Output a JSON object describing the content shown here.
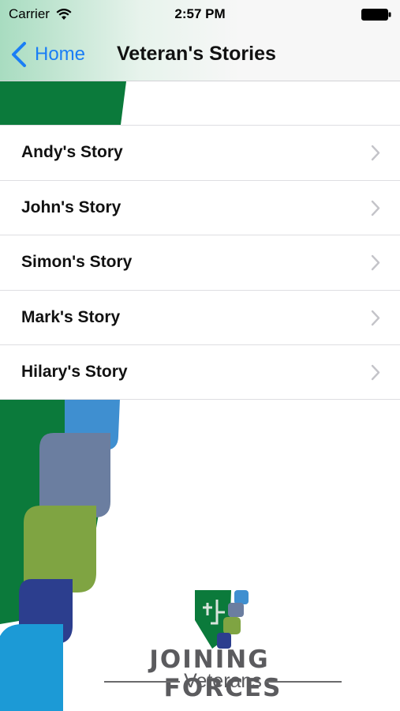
{
  "status_bar": {
    "carrier": "Carrier",
    "time": "2:57 PM"
  },
  "nav": {
    "back_label": "Home",
    "title": "Veteran's Stories"
  },
  "stories": [
    {
      "label": "Andy's Story"
    },
    {
      "label": "John's Story"
    },
    {
      "label": "Simon's Story"
    },
    {
      "label": "Mark's Story"
    },
    {
      "label": "Hilary's Story"
    }
  ],
  "logo": {
    "word_1": "Joining",
    "word_2": "Forces",
    "subtitle": "Veterans"
  },
  "colors": {
    "accent": "#1a7ef5",
    "green": "#0b7a3b",
    "blue": "#3f8fd0",
    "slate": "#6b7ea0",
    "olive": "#7fa442",
    "navy": "#2c3e8e",
    "sky": "#1c9ad6"
  }
}
